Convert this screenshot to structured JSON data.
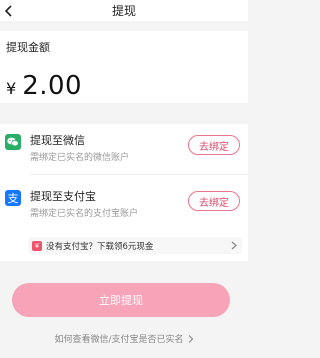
{
  "nav": {
    "title": "提现",
    "back_icon": "chevron-left-icon"
  },
  "amount": {
    "label": "提现金额",
    "currency": "¥",
    "value": "2.00"
  },
  "methods": [
    {
      "name": "提现至微信",
      "desc": "需绑定已实名的微信账户",
      "action": "去绑定",
      "icon": "wechat-icon",
      "color": "#2aae67"
    },
    {
      "name": "提现至支付宝",
      "desc": "需绑定已实名的支付宝账户",
      "action": "去绑定",
      "icon": "alipay-icon",
      "color": "#1677ff"
    }
  ],
  "promo": {
    "text": "没有支付宝？下载领6元现金",
    "icon": "red-envelope-icon"
  },
  "submit_label": "立即提现",
  "help_text": "如何查看微信/支付宝是否已实名",
  "colors": {
    "accent": "#d84b6b",
    "button": "#f7a3b8",
    "background": "#f4f4f4"
  }
}
